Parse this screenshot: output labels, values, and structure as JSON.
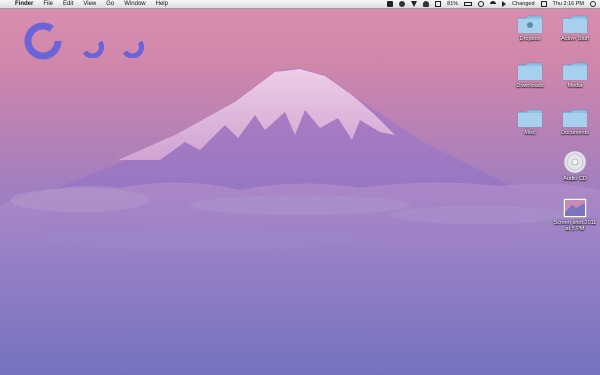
{
  "menubar": {
    "apple_glyph": "",
    "app_name": "Finder",
    "menus": [
      "File",
      "Edit",
      "View",
      "Go",
      "Window",
      "Help"
    ],
    "battery": "81%",
    "user": "Changed",
    "clock": "Thu 2:16 PM"
  },
  "desktop_icons": [
    {
      "label": "Dropbox",
      "kind": "folder"
    },
    {
      "label": "Active Stuff",
      "kind": "folder"
    },
    {
      "label": "Downloads",
      "kind": "folder"
    },
    {
      "label": "Media",
      "kind": "folder"
    },
    {
      "label": "Misc",
      "kind": "folder"
    },
    {
      "label": "Documents",
      "kind": "folder"
    },
    {
      "label": "Audio CD",
      "kind": "cd"
    },
    {
      "label": "Screen shot 2011 at 5 PM",
      "kind": "image"
    }
  ],
  "colors": {
    "widget_accent": "#6b63d8",
    "folder": "#8fc1e6"
  }
}
